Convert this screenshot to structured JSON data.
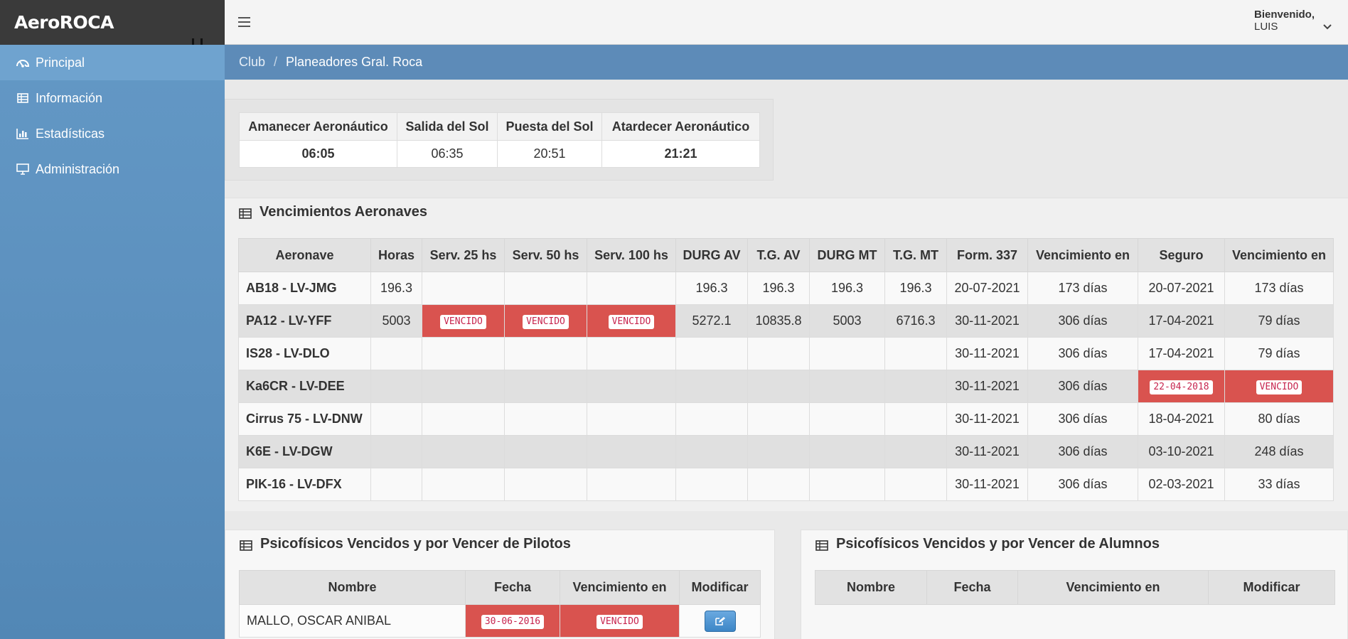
{
  "app": {
    "brand": "AeroROCA"
  },
  "sidebar": {
    "items": [
      {
        "label": "Principal",
        "icon": "dashboard-icon"
      },
      {
        "label": "Información",
        "icon": "table-icon"
      },
      {
        "label": "Estadísticas",
        "icon": "bar-chart-icon"
      },
      {
        "label": "Administración",
        "icon": "desktop-icon"
      }
    ]
  },
  "topbar": {
    "greeting": "Bienvenido,",
    "user": "LUIS"
  },
  "breadcrumb": {
    "root": "Club",
    "separator": "/",
    "current": "Planeadores Gral. Roca"
  },
  "sun": {
    "headers": [
      "Amanecer Aeronáutico",
      "Salida del Sol",
      "Puesta del Sol",
      "Atardecer Aeronáutico"
    ],
    "values": [
      "06:05",
      "06:35",
      "20:51",
      "21:21"
    ]
  },
  "aircraft": {
    "title": "Vencimientos Aeronaves",
    "headers": [
      "Aeronave",
      "Horas",
      "Serv. 25 hs",
      "Serv. 50 hs",
      "Serv. 100 hs",
      "DURG AV",
      "T.G. AV",
      "DURG MT",
      "T.G. MT",
      "Form. 337",
      "Vencimiento en",
      "Seguro",
      "Vencimiento en"
    ],
    "rows": [
      [
        "AB18 - LV-JMG",
        "196.3",
        "",
        "",
        "",
        "196.3",
        "196.3",
        "196.3",
        "196.3",
        "20-07-2021",
        "173 días",
        "20-07-2021",
        "173 días"
      ],
      [
        "PA12 - LV-YFF",
        "5003",
        "VENCIDO",
        "VENCIDO",
        "VENCIDO",
        "5272.1",
        "10835.8",
        "5003",
        "6716.3",
        "30-11-2021",
        "306 días",
        "17-04-2021",
        "79 días"
      ],
      [
        "IS28 - LV-DLO",
        "",
        "",
        "",
        "",
        "",
        "",
        "",
        "",
        "30-11-2021",
        "306 días",
        "17-04-2021",
        "79 días"
      ],
      [
        "Ka6CR - LV-DEE",
        "",
        "",
        "",
        "",
        "",
        "",
        "",
        "",
        "30-11-2021",
        "306 días",
        "22-04-2018",
        "VENCIDO"
      ],
      [
        "Cirrus 75 - LV-DNW",
        "",
        "",
        "",
        "",
        "",
        "",
        "",
        "",
        "30-11-2021",
        "306 días",
        "18-04-2021",
        "80 días"
      ],
      [
        "K6E - LV-DGW",
        "",
        "",
        "",
        "",
        "",
        "",
        "",
        "",
        "30-11-2021",
        "306 días",
        "03-10-2021",
        "248 días"
      ],
      [
        "PIK-16 - LV-DFX",
        "",
        "",
        "",
        "",
        "",
        "",
        "",
        "",
        "30-11-2021",
        "306 días",
        "02-03-2021",
        "33 días"
      ]
    ],
    "alerts": [
      [
        1,
        2
      ],
      [
        1,
        3
      ],
      [
        1,
        4
      ],
      [
        3,
        11
      ],
      [
        3,
        12
      ]
    ]
  },
  "pilots": {
    "title": "Psicofísicos Vencidos y por Vencer de Pilotos",
    "headers": [
      "Nombre",
      "Fecha",
      "Vencimiento en",
      "Modificar"
    ],
    "rows": [
      {
        "name": "MALLO, OSCAR ANIBAL",
        "date": "30-06-2016",
        "status": "VENCIDO"
      }
    ]
  },
  "students": {
    "title": "Psicofísicos Vencidos y por Vencer de Alumnos",
    "headers": [
      "Nombre",
      "Fecha",
      "Vencimiento en",
      "Modificar"
    ]
  },
  "colors": {
    "danger": "#d9534f",
    "header": "#3a3a3a",
    "sidebar": "#5b8fbd",
    "breadcrumb": "#5d8bb8",
    "tag_text": "#c7254e"
  }
}
